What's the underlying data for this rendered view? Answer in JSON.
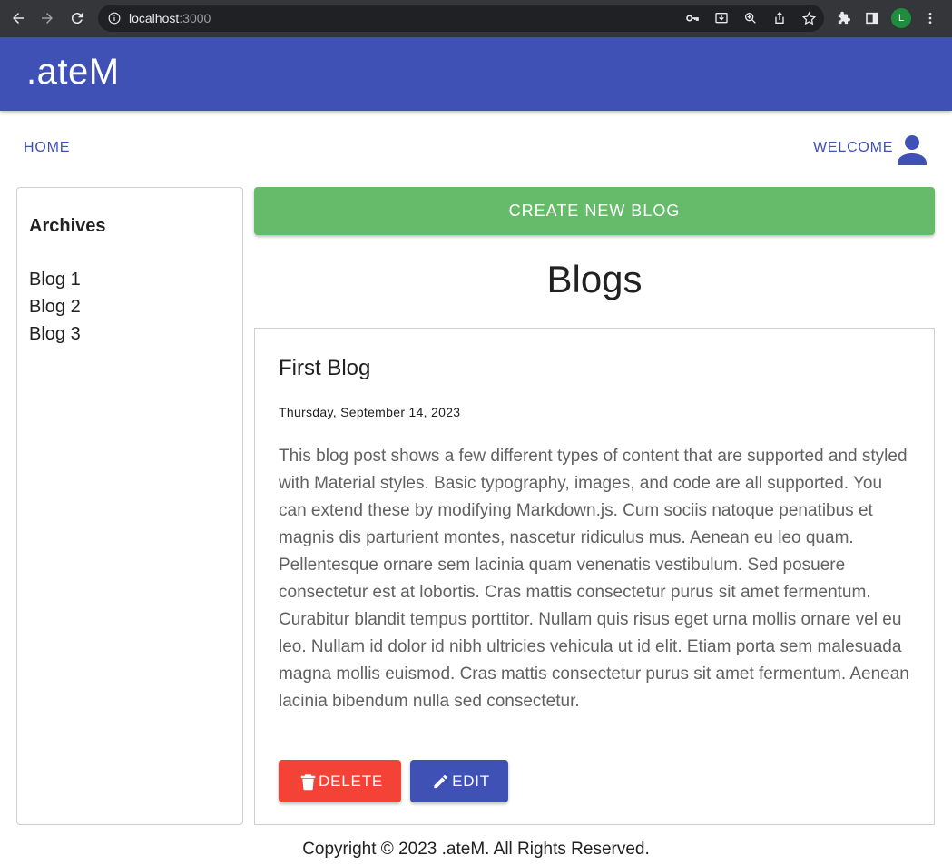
{
  "browser": {
    "url_host": "localhost",
    "url_port": ":3000",
    "profile_initial": "L"
  },
  "header": {
    "brand": ".ateM"
  },
  "nav": {
    "home": "HOME",
    "welcome": "WELCOME"
  },
  "archives": {
    "title": "Archives",
    "items": [
      "Blog 1",
      "Blog 2",
      "Blog 3"
    ]
  },
  "main": {
    "create_button": "CREATE NEW BLOG",
    "heading": "Blogs",
    "post": {
      "title": "First Blog",
      "date": "Thursday, September 14, 2023",
      "body": "This blog post shows a few different types of content that are supported and styled with Material styles. Basic typography, images, and code are all supported. You can extend these by modifying Markdown.js. Cum sociis natoque penatibus et magnis dis parturient montes, nascetur ridiculus mus. Aenean eu leo quam. Pellentesque ornare sem lacinia quam venenatis vestibulum. Sed posuere consectetur est at lobortis. Cras mattis consectetur purus sit amet fermentum. Curabitur blandit tempus porttitor. Nullam quis risus eget urna mollis ornare vel eu leo. Nullam id dolor id nibh ultricies vehicula ut id elit. Etiam porta sem malesuada magna mollis euismod. Cras mattis consectetur purus sit amet fermentum. Aenean lacinia bibendum nulla sed consectetur.",
      "delete_label": "DELETE",
      "edit_label": "EDIT"
    }
  },
  "footer": {
    "copyright": "Copyright © 2023 .ateM. All Rights Reserved."
  },
  "colors": {
    "primary": "#3f51b5",
    "success": "#66bb6a",
    "danger": "#f44336"
  }
}
